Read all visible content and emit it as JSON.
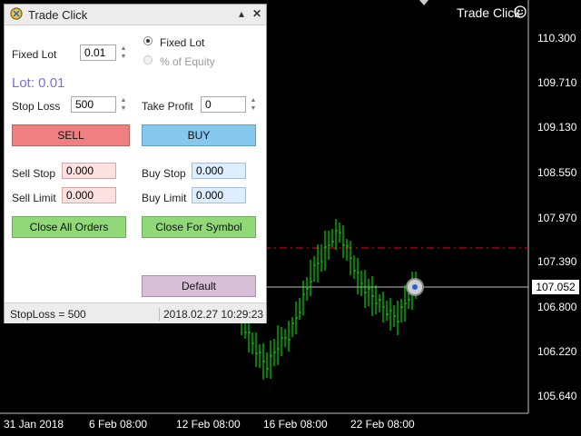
{
  "panel": {
    "title": "Trade Click",
    "minimize_label": "▴",
    "close_label": "✕",
    "fixed_lot_label": "Fixed Lot",
    "fixed_lot_value": "0.01",
    "radio_fixed_lot": "Fixed Lot",
    "radio_equity": "% of Equity",
    "lot_display": "Lot: 0.01",
    "stop_loss_label": "Stop Loss",
    "stop_loss_value": "500",
    "take_profit_label": "Take Profit",
    "take_profit_value": "0",
    "sell_label": "SELL",
    "buy_label": "BUY",
    "sell_stop_label": "Sell Stop",
    "sell_stop_value": "0.000",
    "buy_stop_label": "Buy Stop",
    "buy_stop_value": "0.000",
    "sell_limit_label": "Sell Limit",
    "sell_limit_value": "0.000",
    "buy_limit_label": "Buy Limit",
    "buy_limit_value": "0.000",
    "close_all_label": "Close All Orders",
    "close_symbol_label": "Close For Symbol",
    "default_label": "Default",
    "status_left": "StopLoss = 500",
    "status_right": "2018.02.27 10:29:23"
  },
  "chart": {
    "indicator_label": "Trade Click",
    "current_price": "107.052",
    "price_ticks": [
      "110.300",
      "109.710",
      "109.130",
      "108.550",
      "107.970",
      "107.390",
      "106.800",
      "106.220",
      "105.640"
    ],
    "time_ticks": [
      "31 Jan 2018",
      "6 Feb 08:00",
      "12 Feb 08:00",
      "16 Feb 08:00",
      "22 Feb 08:00"
    ],
    "colors": {
      "background": "#000000",
      "bars": "#00ff00",
      "stop_line": "#ff0000",
      "bid_line": "#c0c0c0"
    }
  }
}
